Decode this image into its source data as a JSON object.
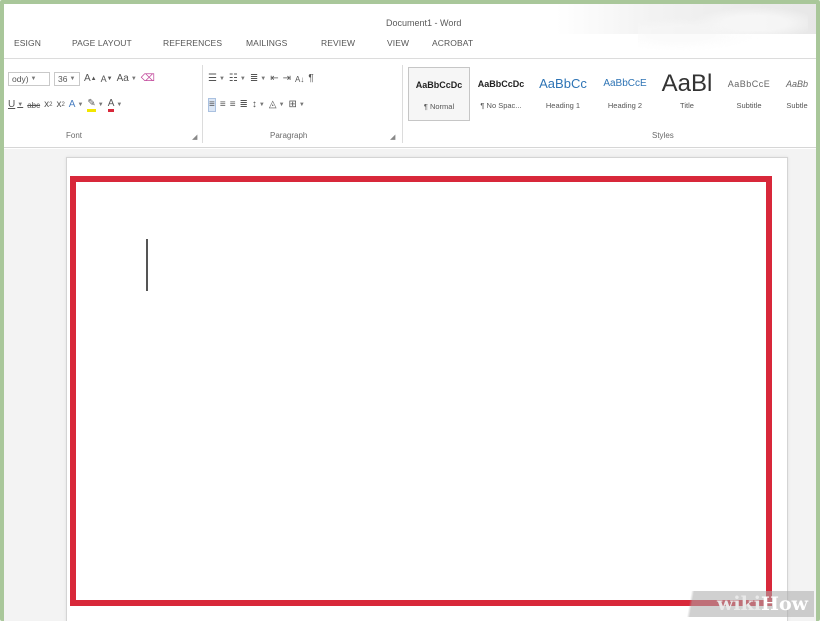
{
  "window": {
    "title": "Document1 - Word"
  },
  "tabs": [
    "ESIGN",
    "PAGE LAYOUT",
    "REFERENCES",
    "MAILINGS",
    "REVIEW",
    "VIEW",
    "ACROBAT"
  ],
  "font_group": {
    "font_name": "ody)",
    "font_size": "36",
    "grow": "A",
    "shrink": "A",
    "change_case": "Aa",
    "underline": "U",
    "strikethrough": "abc",
    "subscript": "x",
    "superscript": "x",
    "text_effects": "A",
    "font_color": "A",
    "label": "Font"
  },
  "paragraph_group": {
    "sort": "A↓",
    "show_marks": "¶",
    "label": "Paragraph"
  },
  "styles_group": {
    "label": "Styles",
    "items": [
      {
        "sample": "AaBbCcDc",
        "name": "¶ Normal"
      },
      {
        "sample": "AaBbCcDc",
        "name": "¶ No Spac..."
      },
      {
        "sample": "AaBbCc",
        "name": "Heading 1"
      },
      {
        "sample": "AaBbCcE",
        "name": "Heading 2"
      },
      {
        "sample": "AaBl",
        "name": "Title"
      },
      {
        "sample": "AaBbCcE",
        "name": "Subtitle"
      },
      {
        "sample": "AaBb",
        "name": "Subtle"
      }
    ]
  },
  "watermark": {
    "part1": "wiki",
    "part2": "How"
  },
  "colors": {
    "highlight_border": "#d8283a",
    "frame_border": "#a9c79a",
    "style_heading": "#2e74b5"
  }
}
